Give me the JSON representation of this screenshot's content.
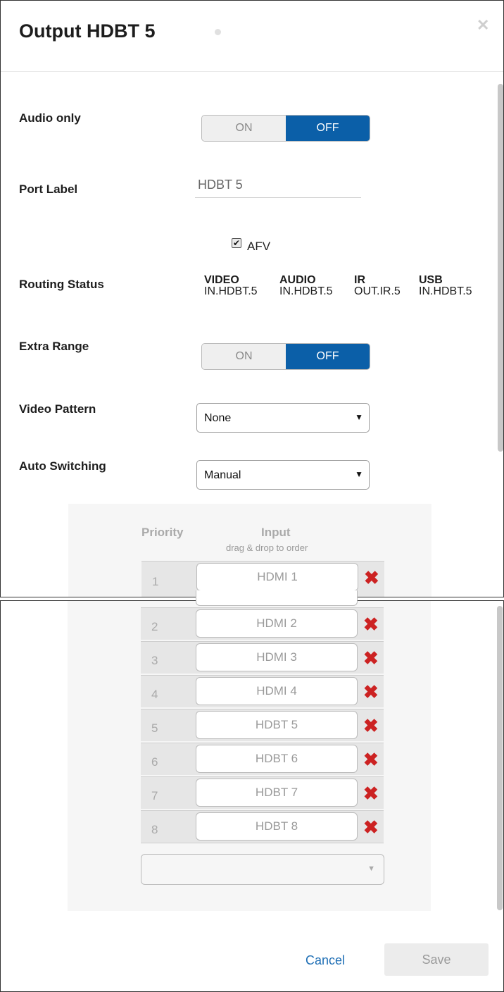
{
  "dialog": {
    "title": "Output HDBT 5",
    "close_icon": "close-icon"
  },
  "audio_only": {
    "label": "Audio only",
    "on_label": "ON",
    "off_label": "OFF",
    "selected": "OFF"
  },
  "port_label": {
    "label": "Port Label",
    "value": "HDBT 5"
  },
  "afv": {
    "label": "AFV",
    "checked": true
  },
  "routing_status": {
    "label": "Routing Status",
    "columns": [
      {
        "header": "VIDEO",
        "value": "IN.HDBT.5"
      },
      {
        "header": "AUDIO",
        "value": "IN.HDBT.5"
      },
      {
        "header": "IR",
        "value": "OUT.IR.5"
      },
      {
        "header": "USB",
        "value": "IN.HDBT.5"
      }
    ]
  },
  "extra_range": {
    "label": "Extra Range",
    "on_label": "ON",
    "off_label": "OFF",
    "selected": "OFF"
  },
  "video_pattern": {
    "label": "Video Pattern",
    "value": "None"
  },
  "auto_switching": {
    "label": "Auto Switching",
    "value": "Manual"
  },
  "priority": {
    "priority_header": "Priority",
    "input_header": "Input",
    "input_subheader": "drag & drop to order",
    "rows": [
      {
        "num": "1",
        "input": "HDMI 1"
      },
      {
        "num": "2",
        "input": "HDMI 2"
      },
      {
        "num": "3",
        "input": "HDMI 3"
      },
      {
        "num": "4",
        "input": "HDMI 4"
      },
      {
        "num": "5",
        "input": "HDBT 5"
      },
      {
        "num": "6",
        "input": "HDBT 6"
      },
      {
        "num": "7",
        "input": "HDBT 7"
      },
      {
        "num": "8",
        "input": "HDBT 8"
      }
    ],
    "add_select_value": ""
  },
  "footer": {
    "cancel_label": "Cancel",
    "save_label": "Save"
  },
  "colors": {
    "accent": "#0b5fa8",
    "remove": "#cc2222",
    "link": "#1f6fb5"
  }
}
